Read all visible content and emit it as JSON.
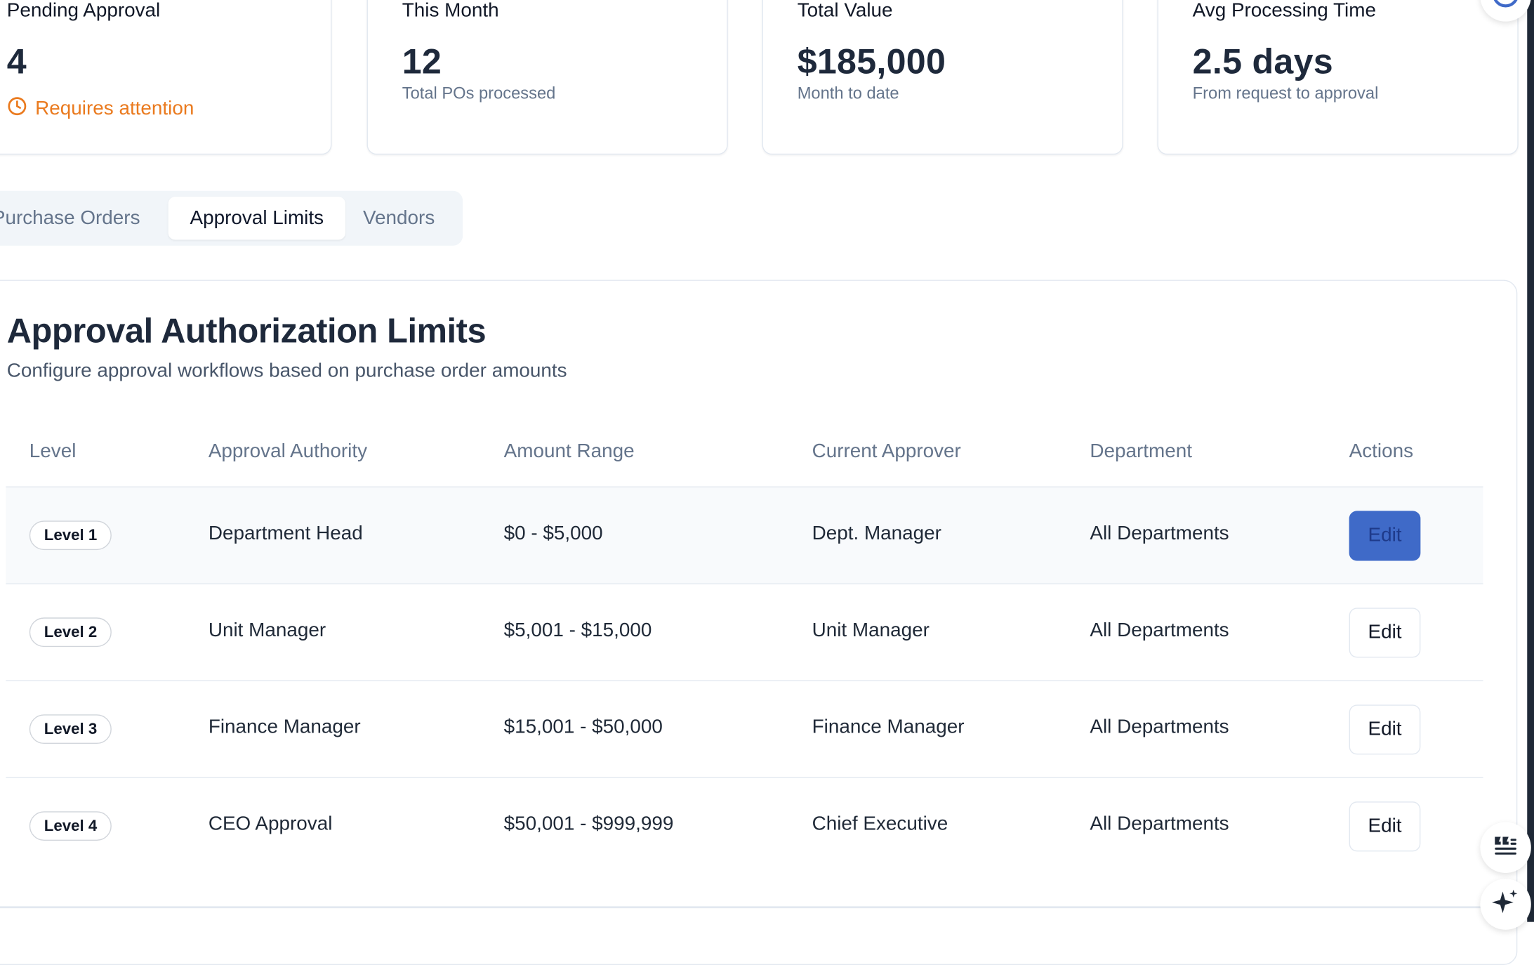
{
  "stats": [
    {
      "title": "Pending Approval",
      "value": "4",
      "note": "Requires attention",
      "note_icon": "clock-icon"
    },
    {
      "title": "This Month",
      "value": "12",
      "sub": "Total POs processed"
    },
    {
      "title": "Total Value",
      "value": "$185,000",
      "sub": "Month to date"
    },
    {
      "title": "Avg Processing Time",
      "value": "2.5 days",
      "sub": "From request to approval"
    }
  ],
  "tabs": [
    {
      "label": "Purchase Orders",
      "active": false
    },
    {
      "label": "Approval Limits",
      "active": true
    },
    {
      "label": "Vendors",
      "active": false
    }
  ],
  "section": {
    "title": "Approval Authorization Limits",
    "subtitle": "Configure approval workflows based on purchase order amounts"
  },
  "table": {
    "headers": [
      "Level",
      "Approval Authority",
      "Amount Range",
      "Current Approver",
      "Department",
      "Actions"
    ],
    "rows": [
      {
        "level": "Level 1",
        "authority": "Department Head",
        "range": "$0 - $5,000",
        "approver": "Dept. Manager",
        "department": "All Departments",
        "action": "Edit"
      },
      {
        "level": "Level 2",
        "authority": "Unit Manager",
        "range": "$5,001 - $15,000",
        "approver": "Unit Manager",
        "department": "All Departments",
        "action": "Edit"
      },
      {
        "level": "Level 3",
        "authority": "Finance Manager",
        "range": "$15,001 - $50,000",
        "approver": "Finance Manager",
        "department": "All Departments",
        "action": "Edit"
      },
      {
        "level": "Level 4",
        "authority": "CEO Approval",
        "range": "$50,001 - $999,999",
        "approver": "Chief Executive",
        "department": "All Departments",
        "action": "Edit"
      }
    ]
  },
  "colors": {
    "accent": "#3f6ac8",
    "attention": "#ea7a1e",
    "muted": "#64748b"
  },
  "widgets": [
    "quote-icon",
    "sparkle-icon",
    "profile-icon"
  ]
}
